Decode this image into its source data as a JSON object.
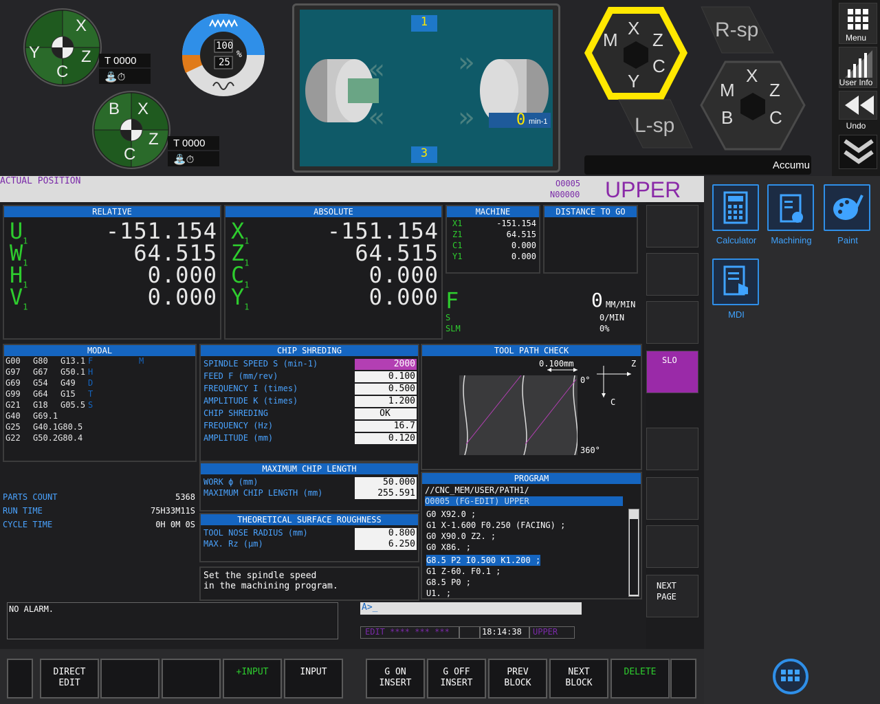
{
  "top": {
    "tool1": "T 0000",
    "tool2": "T 0000",
    "ring1": [
      "X",
      "Y",
      "C",
      "Z"
    ],
    "ring2": [
      "B",
      "X",
      "Z",
      "C"
    ],
    "override_top": "100",
    "override_bottom": "25",
    "override_unit": "%",
    "turret1": "1",
    "turret3": "3",
    "spindle_speed": "0",
    "spindle_unit": "min-1",
    "hex1": [
      "X",
      "M",
      "Z",
      "Y",
      "C"
    ],
    "hex2": [
      "X",
      "M",
      "Z",
      "B",
      "C"
    ],
    "rsp": "R-sp",
    "lsp": "L-sp",
    "accum": "Accumu"
  },
  "rightbar": {
    "menu": "Menu",
    "userinfo": "User Info",
    "undo": "Undo"
  },
  "status": {
    "title": "ACTUAL POSITION",
    "o": "O0005",
    "n": "N00000",
    "path": "UPPER"
  },
  "relative": {
    "header": "RELATIVE",
    "rows": [
      {
        "ax": "U",
        "sub": "1",
        "val": "-151.154"
      },
      {
        "ax": "W",
        "sub": "1",
        "val": "64.515"
      },
      {
        "ax": "H",
        "sub": "1",
        "val": "0.000"
      },
      {
        "ax": "V",
        "sub": "1",
        "val": "0.000"
      }
    ]
  },
  "absolute": {
    "header": "ABSOLUTE",
    "rows": [
      {
        "ax": "X",
        "sub": "1",
        "val": "-151.154"
      },
      {
        "ax": "Z",
        "sub": "1",
        "val": "64.515"
      },
      {
        "ax": "C",
        "sub": "1",
        "val": "0.000"
      },
      {
        "ax": "Y",
        "sub": "1",
        "val": "0.000"
      }
    ]
  },
  "machine": {
    "header": "MACHINE",
    "rows": [
      [
        "X1",
        "-151.154"
      ],
      [
        "Z1",
        "64.515"
      ],
      [
        "C1",
        "0.000"
      ],
      [
        "Y1",
        "0.000"
      ]
    ]
  },
  "dtg": {
    "header": "DISTANCE TO GO"
  },
  "feed": {
    "f_label": "F",
    "f_val": "0",
    "f_unit": "MM/MIN",
    "s_label": "S",
    "s_val": "0/MIN",
    "slm_label": "SLM",
    "slm_val": "0%"
  },
  "modal": {
    "header": "MODAL",
    "rows": [
      [
        "G00",
        "G80",
        "G13.1",
        "F",
        "M"
      ],
      [
        "G97",
        "G67",
        "G50.1",
        "H",
        ""
      ],
      [
        "G69",
        "G54",
        "G49",
        "D",
        ""
      ],
      [
        "G99",
        "G64",
        "G15",
        "T",
        ""
      ],
      [
        "G21",
        "G18",
        "G05.5",
        "S",
        ""
      ],
      [
        "G40",
        "G69.1",
        "",
        "",
        ""
      ],
      [
        "G25",
        "G40.1G80.5",
        "",
        "",
        ""
      ],
      [
        "G22",
        "G50.2G80.4",
        "",
        "",
        ""
      ]
    ]
  },
  "counts": [
    [
      "PARTS COUNT",
      "5368"
    ],
    [
      "RUN TIME",
      "75H33M11S"
    ],
    [
      "CYCLE TIME",
      "0H 0M 0S"
    ]
  ],
  "chip": {
    "header": "CHIP SHREDING",
    "rows": [
      [
        "SPINDLE SPEED S (min-1)",
        "2000"
      ],
      [
        "FEED F (mm/rev)",
        "0.100"
      ],
      [
        "FREQUENCY I (times)",
        "0.500"
      ],
      [
        "AMPLITUDE K (times)",
        "1.200"
      ],
      [
        "CHIP SHREDING",
        "OK"
      ],
      [
        "FREQUENCY (Hz)",
        "16.7"
      ],
      [
        "AMPLITUDE (mm)",
        "0.120"
      ]
    ]
  },
  "maxchip": {
    "header": "MAXIMUM CHIP LENGTH",
    "rows": [
      [
        "WORK ϕ (mm)",
        "50.000"
      ],
      [
        "MAXIMUM CHIP LENGTH (mm)",
        "255.591"
      ]
    ]
  },
  "rough": {
    "header": "THEORETICAL SURFACE ROUGHNESS",
    "rows": [
      [
        "TOOL NOSE RADIUS (mm)",
        "0.800"
      ],
      [
        "MAX. Rz (μm)",
        "6.250"
      ]
    ]
  },
  "hint": {
    "line1": "Set the spindle speed",
    "line2": "in the machining program."
  },
  "toolpath": {
    "header": "TOOL PATH CHECK",
    "scale": "0.100mm",
    "z": "Z",
    "c": "C",
    "deg0": "0°",
    "deg360": "360°"
  },
  "program": {
    "header": "PROGRAM",
    "path": "//CNC_MEM/USER/PATH1/",
    "sel": "O0005            (FG-EDIT) UPPER",
    "lines": [
      "G0 X92.0 ;",
      "G1 X-1.600 F0.250 (FACING) ;",
      "G0 X90.0 Z2. ;",
      "G0 X86. ;",
      "G8.5 P2 I0.500 K1.200 ;",
      "G1 Z-60. F0.1 ;",
      "G8.5 P0 ;",
      "U1. ;"
    ]
  },
  "alarm": "NO ALARM.",
  "input": "A>_",
  "edit": {
    "mode": "EDIT **** *** ***",
    "time": "18:14:38",
    "path": "UPPER"
  },
  "rsk": {
    "slo": "SLO",
    "next1": "NEXT",
    "next2": "PAGE"
  },
  "softkeys": [
    [
      "",
      ""
    ],
    [
      "DIRECT",
      "EDIT"
    ],
    [
      "",
      ""
    ],
    [
      "",
      ""
    ],
    [
      "+INPUT",
      ""
    ],
    [
      "INPUT",
      ""
    ],
    [
      "G ON",
      "INSERT"
    ],
    [
      "G OFF",
      "INSERT"
    ],
    [
      "PREV",
      "BLOCK"
    ],
    [
      "NEXT",
      "BLOCK"
    ],
    [
      "DELETE",
      ""
    ],
    [
      "",
      ""
    ]
  ],
  "apps": {
    "calc": "Calculator",
    "mach": "Machining",
    "paint": "Paint",
    "mdi": "MDI"
  }
}
